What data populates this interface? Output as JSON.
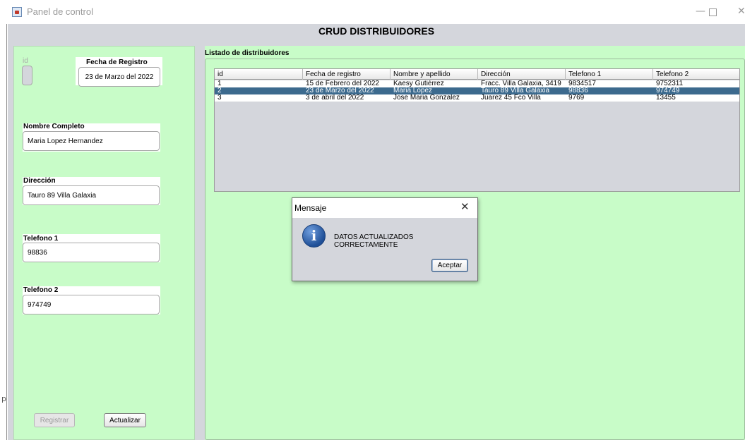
{
  "window": {
    "title": "Panel de control",
    "min_glyph": "—",
    "close_glyph": "✕",
    "side_mark": "p"
  },
  "heading": "CRUD DISTRIBUIDORES",
  "form": {
    "id_label": "id",
    "id_value": "",
    "fecha_label": "Fecha de Registro",
    "fecha_value": "23 de Marzo del 2022",
    "nombre_label": "Nombre Completo",
    "nombre_value": "Maria Lopez Hernandez",
    "direccion_label": "Dirección",
    "direccion_value": "Tauro 89 Villa Galaxia",
    "telefono1_label": "Telefono 1",
    "telefono1_value": "98836",
    "telefono2_label": "Telefono 2",
    "telefono2_value": "974749",
    "registrar_label": "Registrar",
    "actualizar_label": "Actualizar"
  },
  "list": {
    "title": "Listado de distribuidores",
    "columns": [
      "id",
      "Fecha de registro",
      "Nombre y apellido",
      "Dirección",
      "Telefono 1",
      "Telefono 2"
    ],
    "rows": [
      [
        "1",
        "15 de Febrero del 2022",
        "Kaesy Gutiérrez",
        "Fracc. Villa Galaxia, 3419",
        "9834517",
        "9752311"
      ],
      [
        "2",
        "23 de Marzo del 2022",
        "Maria Lopez",
        "Tauro 89 Villa Galaxia",
        "98836",
        "974749"
      ],
      [
        "3",
        "3 de abril del 2022",
        "Jose Maria Gonzalez",
        "Juarez 45 Fco Villa",
        "9769",
        "13455"
      ]
    ],
    "selected_row": 1
  },
  "dialog": {
    "title": "Mensaje",
    "close_glyph": "✕",
    "icon_glyph": "i",
    "message": "DATOS ACTUALIZADOS CORRECTAMENTE",
    "button_label": "Aceptar"
  }
}
